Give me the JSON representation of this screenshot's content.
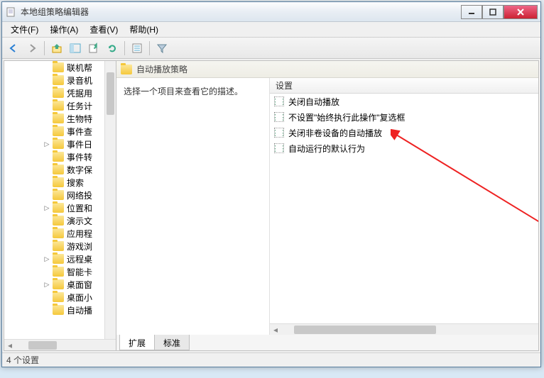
{
  "window": {
    "title": "本地组策略编辑器"
  },
  "menu": {
    "file": "文件(F)",
    "action": "操作(A)",
    "view": "查看(V)",
    "help": "帮助(H)"
  },
  "tree": {
    "items": [
      {
        "label": "联机帮",
        "expand": ""
      },
      {
        "label": "录音机",
        "expand": ""
      },
      {
        "label": "凭据用",
        "expand": ""
      },
      {
        "label": "任务计",
        "expand": ""
      },
      {
        "label": "生物特",
        "expand": ""
      },
      {
        "label": "事件查",
        "expand": ""
      },
      {
        "label": "事件日",
        "expand": "▷"
      },
      {
        "label": "事件转",
        "expand": ""
      },
      {
        "label": "数字保",
        "expand": ""
      },
      {
        "label": "搜索",
        "expand": ""
      },
      {
        "label": "网络投",
        "expand": ""
      },
      {
        "label": "位置和",
        "expand": "▷"
      },
      {
        "label": "演示文",
        "expand": ""
      },
      {
        "label": "应用程",
        "expand": ""
      },
      {
        "label": "游戏浏",
        "expand": ""
      },
      {
        "label": "远程桌",
        "expand": "▷"
      },
      {
        "label": "智能卡",
        "expand": ""
      },
      {
        "label": "桌面窗",
        "expand": "▷"
      },
      {
        "label": "桌面小",
        "expand": ""
      },
      {
        "label": "自动播",
        "expand": ""
      }
    ]
  },
  "header": {
    "title": "自动播放策略"
  },
  "description": "选择一个项目来查看它的描述。",
  "settings": {
    "column": "设置",
    "rows": [
      "关闭自动播放",
      "不设置\"始终执行此操作\"复选框",
      "关闭非卷设备的自动播放",
      "自动运行的默认行为"
    ]
  },
  "tabs": {
    "extended": "扩展",
    "standard": "标准"
  },
  "status": "4 个设置"
}
